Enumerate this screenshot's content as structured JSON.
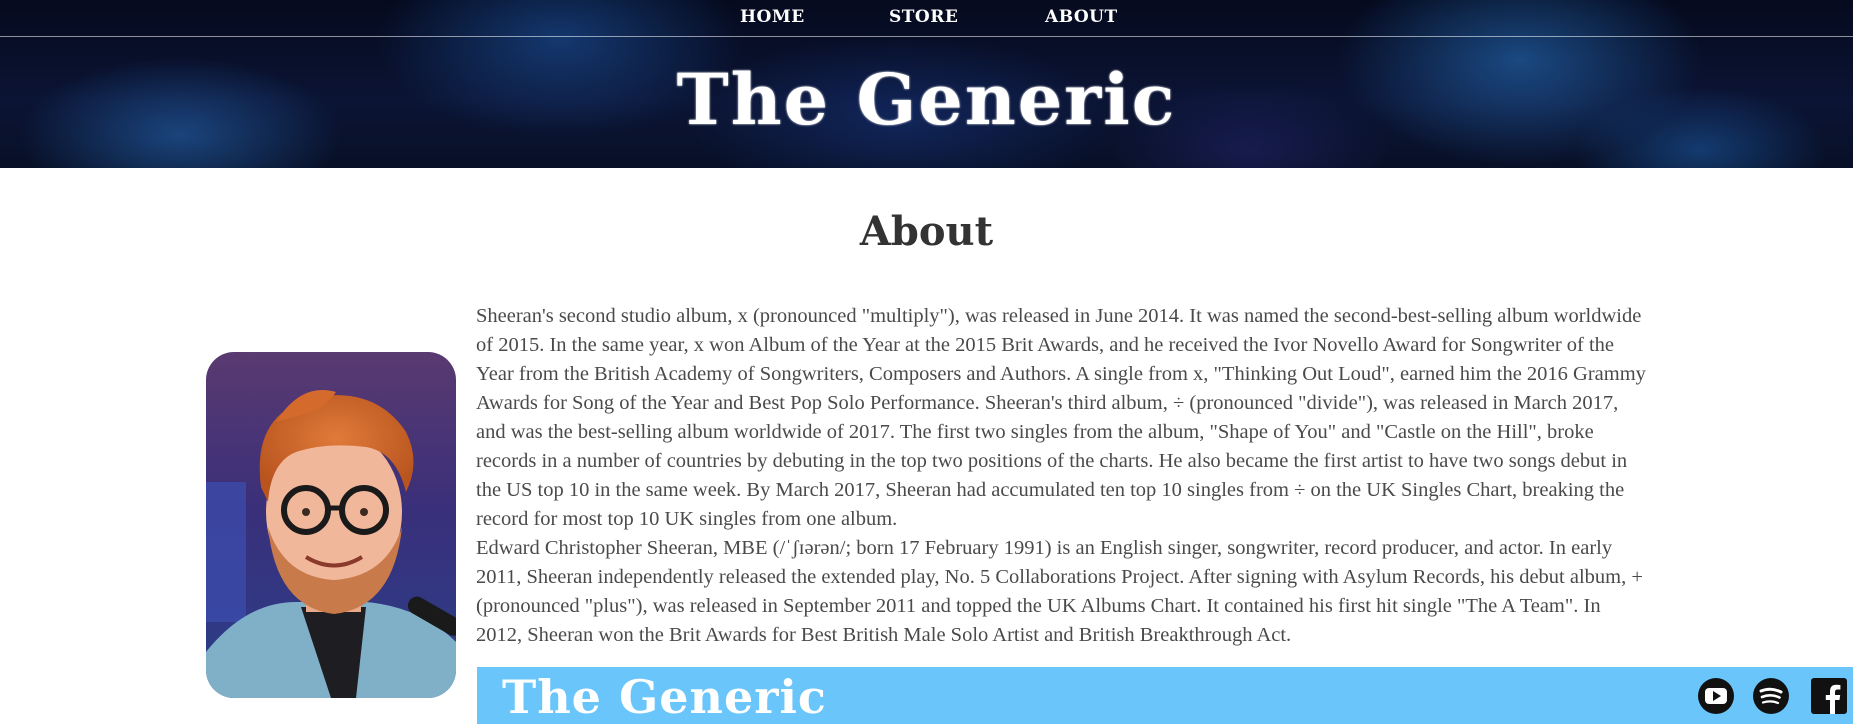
{
  "nav": {
    "items": [
      {
        "label": "HOME"
      },
      {
        "label": "STORE"
      },
      {
        "label": "ABOUT"
      }
    ]
  },
  "header": {
    "title": "The Generic"
  },
  "main": {
    "heading": "About",
    "paragraphs": [
      "Sheeran's second studio album, x (pronounced \"multiply\"), was released in June 2014. It was named the second-best-selling album worldwide of 2015. In the same year, x won Album of the Year at the 2015 Brit Awards, and he received the Ivor Novello Award for Songwriter of the Year from the British Academy of Songwriters, Composers and Authors. A single from x, \"Thinking Out Loud\", earned him the 2016 Grammy Awards for Song of the Year and Best Pop Solo Performance. Sheeran's third album, ÷ (pronounced \"divide\"), was released in March 2017, and was the best-selling album worldwide of 2017. The first two singles from the album, \"Shape of You\" and \"Castle on the Hill\", broke records in a number of countries by debuting in the top two positions of the charts. He also became the first artist to have two songs debut in the US top 10 in the same week. By March 2017, Sheeran had accumulated ten top 10 singles from ÷ on the UK Singles Chart, breaking the record for most top 10 UK singles from one album.",
      "Edward Christopher Sheeran, MBE (/ˈʃɪərən/; born 17 February 1991) is an English singer, songwriter, record producer, and actor. In early 2011, Sheeran independently released the extended play, No. 5 Collaborations Project. After signing with Asylum Records, his debut album, + (pronounced \"plus\"), was released in September 2011 and topped the UK Albums Chart. It contained his first hit single \"The A Team\". In 2012, Sheeran won the Brit Awards for Best British Male Solo Artist and British Breakthrough Act."
    ]
  },
  "footer": {
    "title": "The Generic",
    "social": [
      "youtube-icon",
      "spotify-icon",
      "facebook-icon"
    ]
  },
  "colors": {
    "footer_bg": "#6ac6fa",
    "header_bg": "#0b1434",
    "text": "#4a4a4a"
  }
}
